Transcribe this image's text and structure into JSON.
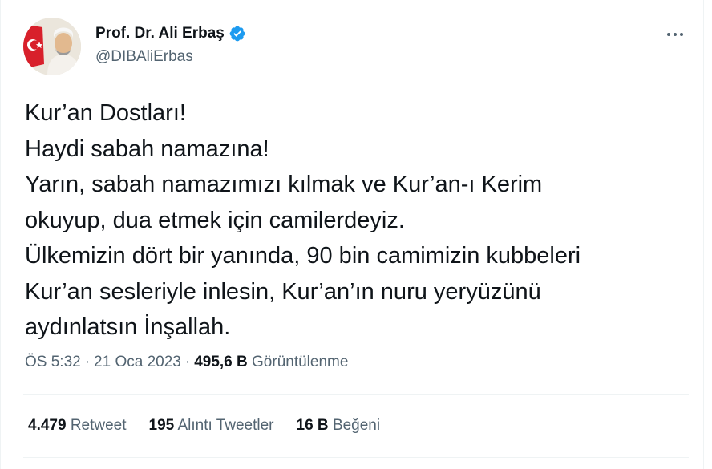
{
  "author": {
    "display_name": "Prof. Dr. Ali Erbaş",
    "handle": "@DIBAliErbas",
    "verified_icon": "verified-badge-icon",
    "accent_color": "#1d9bf0"
  },
  "tweet": {
    "lines": [
      "Kur’an Dostları!",
      "Haydi sabah namazına!",
      "Yarın, sabah namazımızı kılmak ve Kur’an-ı Kerim",
      "okuyup, dua etmek için camilerdeyiz.",
      "Ülkemizin dört bir yanında, 90 bin camimizin kubbeleri",
      "Kur’an sesleriyle inlesin, Kur’an’ın nuru yeryüzünü",
      "aydınlatsın İnşallah."
    ]
  },
  "meta": {
    "time": "ÖS 5:32",
    "date": "21 Oca 2023",
    "separator": "·",
    "views_count": "495,6 B",
    "views_label": "Görüntülenme"
  },
  "stats": {
    "retweets_count": "4.479",
    "retweets_label": "Retweet",
    "quotes_count": "195",
    "quotes_label": "Alıntı Tweetler",
    "likes_count": "16 B",
    "likes_label": "Beğeni"
  }
}
